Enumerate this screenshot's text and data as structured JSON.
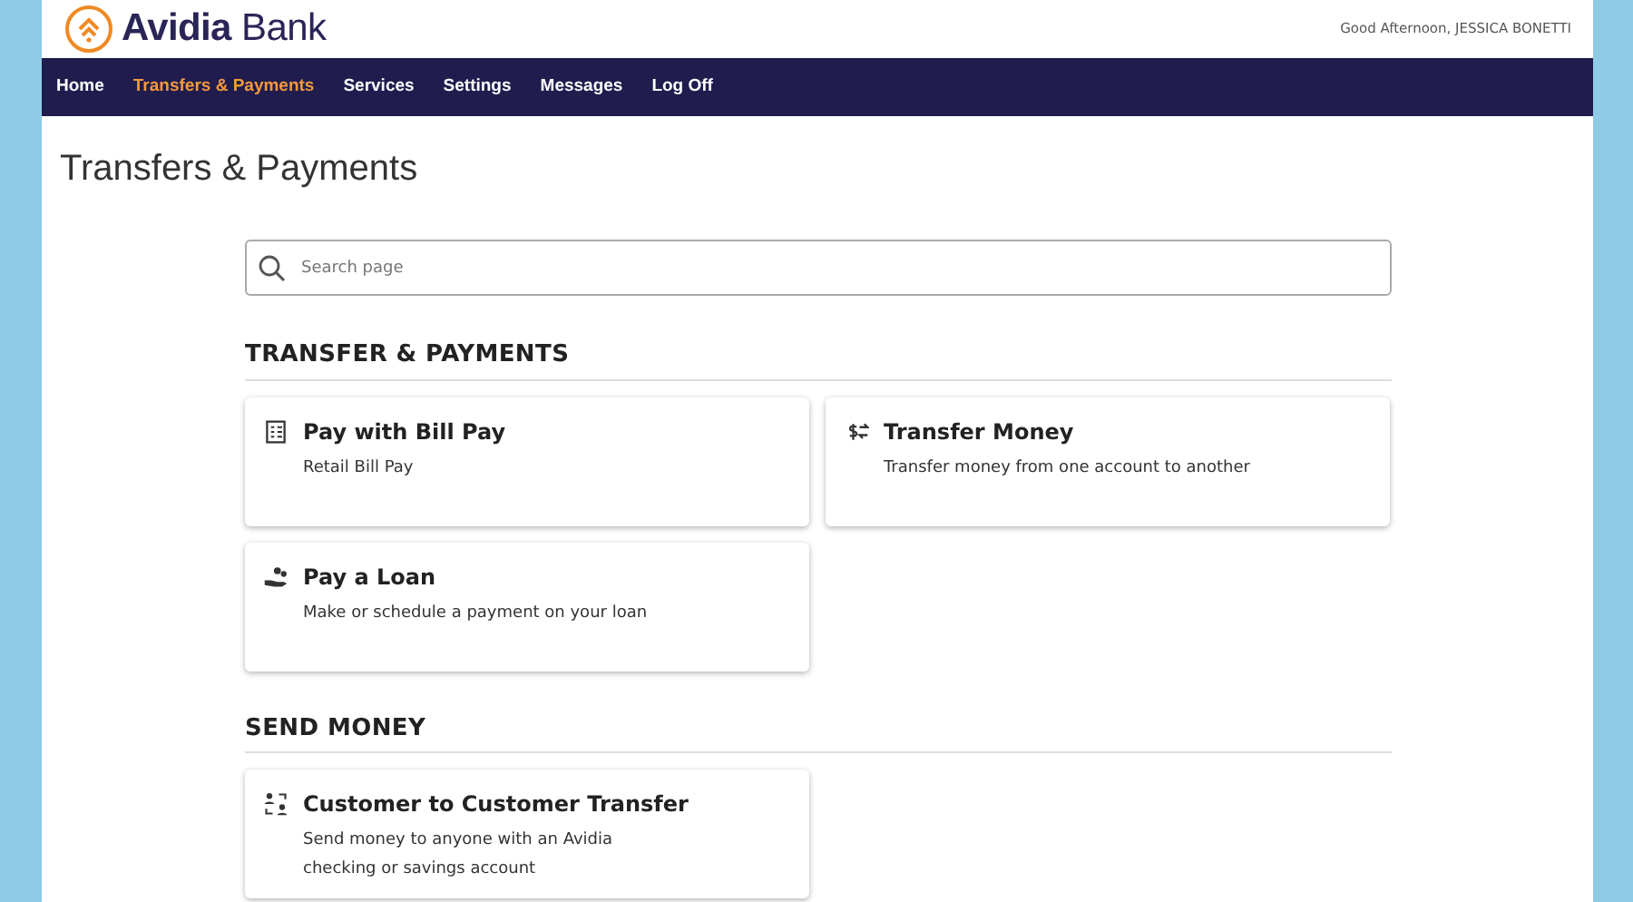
{
  "brand": {
    "name": "**Avidia** Bank"
  },
  "greeting": "Good Afternoon, JESSICA BONETTI",
  "nav": [
    {
      "label": "Home",
      "selected": false
    },
    {
      "label": "Transfers & Payments",
      "selected": true
    },
    {
      "label": "Services",
      "selected": false
    },
    {
      "label": "Settings",
      "selected": false
    },
    {
      "label": "Messages",
      "selected": false
    },
    {
      "label": "Log Off",
      "selected": false
    }
  ],
  "page_title": "Transfers & Payments",
  "search": {
    "placeholder": "Search page"
  },
  "sections": [
    {
      "heading": "TRANSFER & PAYMENTS",
      "cards": [
        {
          "kind": "bill",
          "title": "Pay with Bill Pay",
          "description": "Retail Bill Pay"
        },
        {
          "kind": "transfer",
          "title": "Transfer Money",
          "description": "Transfer money from one account to another"
        },
        {
          "kind": "loan",
          "title": "Pay a Loan",
          "description": "Make or schedule a payment on your loan"
        }
      ]
    },
    {
      "heading": "SEND MONEY",
      "cards": [
        {
          "kind": "people",
          "title": "Customer to Customer Transfer",
          "description": "Send money to anyone with an Avidia checking or savings account"
        }
      ]
    }
  ]
}
